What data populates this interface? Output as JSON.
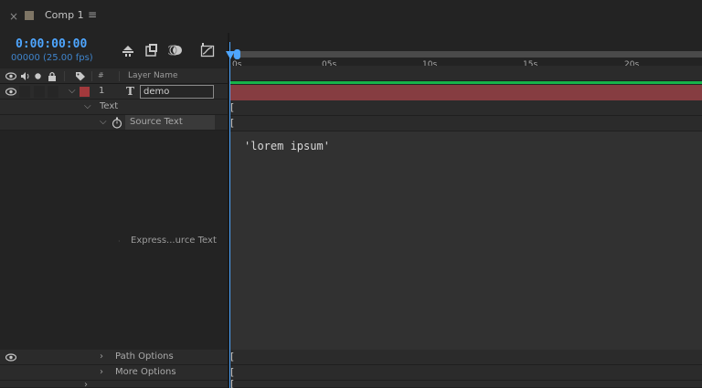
{
  "tab": {
    "close": "×",
    "title": "Comp 1",
    "menu": "≡",
    "swatch_color": "#7e7565"
  },
  "timecode": {
    "current": "0:00:00:00",
    "frames": "00000 (25.00 fps)"
  },
  "toolbar_icons": [
    "shy-layers-icon",
    "frame-blending-icon",
    "motion-blur-icon",
    "graph-editor-icon"
  ],
  "columns": {
    "number": "#",
    "layer_name": "Layer Name"
  },
  "layer": {
    "number": "1",
    "type_glyph": "T",
    "name": "demo",
    "label_color": "#a2393c"
  },
  "properties": {
    "text": "Text",
    "source_text": "Source Text",
    "expression_label": "Express...urce Text",
    "path_options": "Path Options",
    "more_options": "More Options"
  },
  "expression": {
    "code": "'lorem ipsum'"
  },
  "ruler": {
    "ticks": [
      "0s",
      "05s",
      "10s",
      "15s",
      "20s"
    ]
  },
  "colors": {
    "accent": "#4ea6ff",
    "layer_bar": "#863d41",
    "green_bar": "#17b34a"
  }
}
